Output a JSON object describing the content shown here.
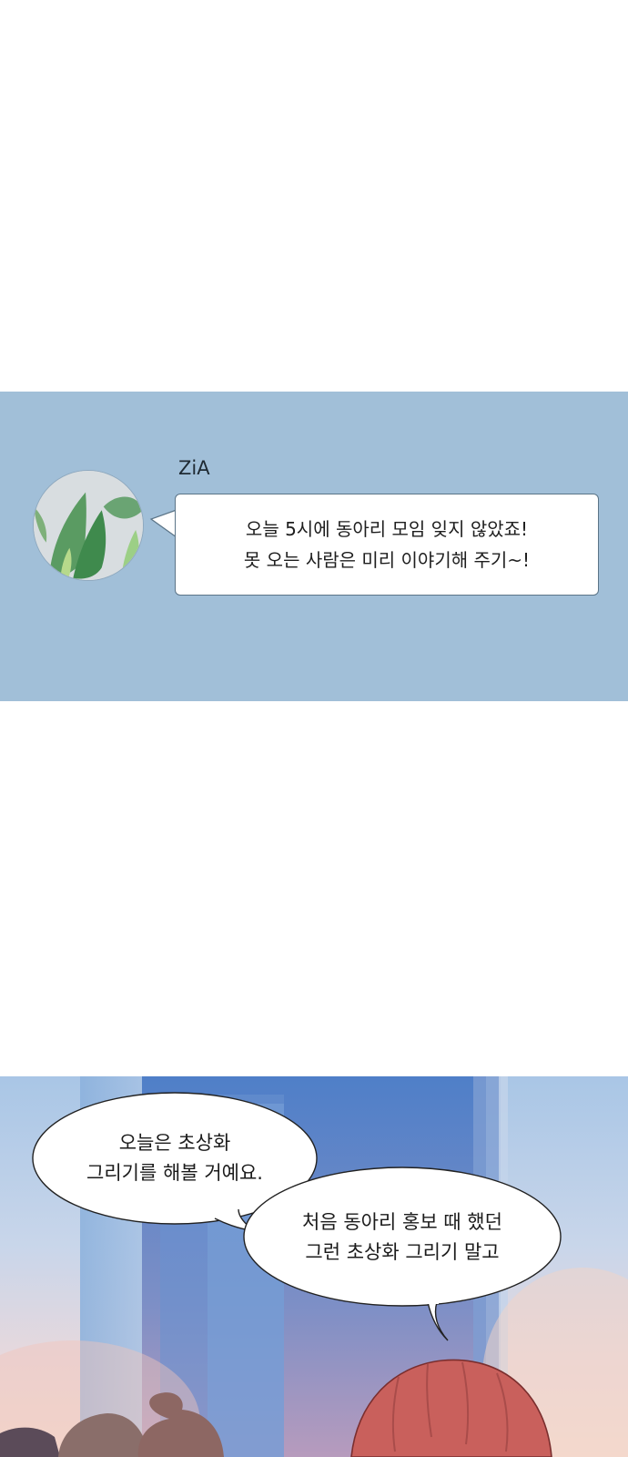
{
  "chat": {
    "sender": "ZiA",
    "message_lines": [
      "오늘 5시에 동아리 모임 잊지 않았죠!",
      "못 오는 사람은 미리 이야기해 주기~!"
    ]
  },
  "scene": {
    "bubble_1_lines": [
      "오늘은 초상화",
      "그리기를 해볼 거예요."
    ],
    "bubble_2_lines": [
      "처음 동아리 홍보 때 했던",
      "그런 초상화 그리기 말고"
    ]
  },
  "colors": {
    "chat_background": "#a1bfd8",
    "bubble_border": "#5b7487",
    "hair": "#c9605c"
  }
}
